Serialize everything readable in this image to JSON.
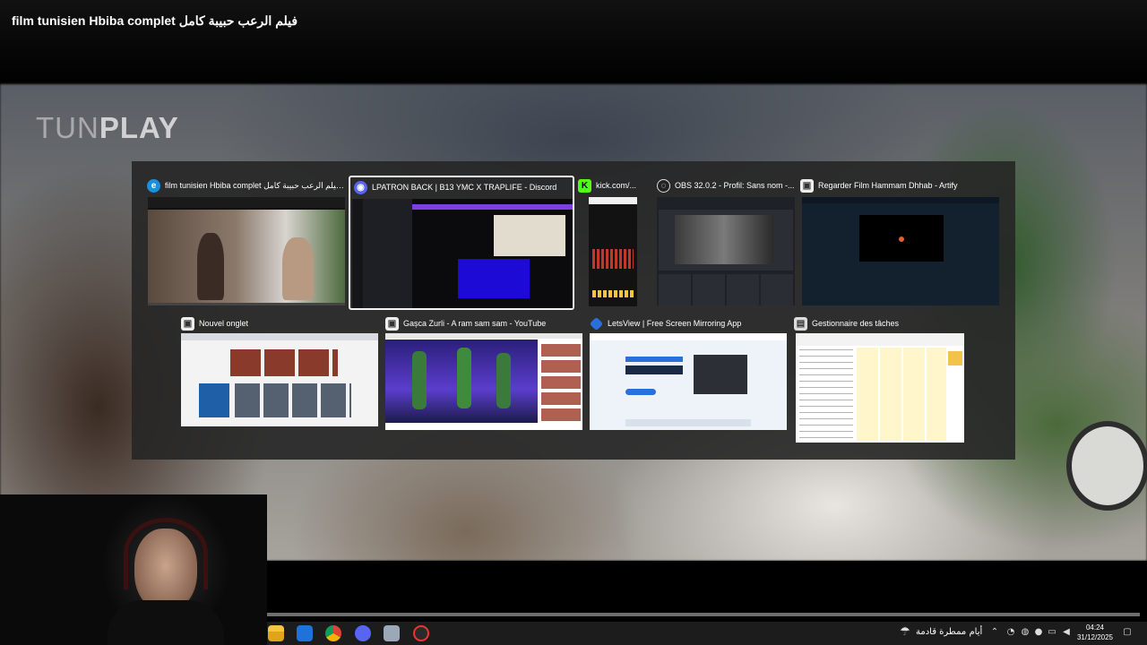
{
  "video": {
    "title": "film tunisien Hbiba complet فيلم الرعب حبيبة كامل",
    "watermark_light": "TUN",
    "watermark_bold": "PLAY"
  },
  "switcher": {
    "windows": [
      {
        "title": "film tunisien Hbiba complet فيلم الرعب حبيبة كامل...",
        "icon": "edge-icon",
        "selected": false
      },
      {
        "title": "LPATRON BACK | B13 YMC X TRAPLIFE - Discord",
        "icon": "discord-icon",
        "selected": true
      },
      {
        "title": "kick.com/...",
        "icon": "kick-icon",
        "selected": false
      },
      {
        "title": "OBS 32.0.2 - Profil: Sans nom -...",
        "icon": "obs-icon",
        "selected": false
      },
      {
        "title": "Regarder Film Hammam Dhhab - Artify",
        "icon": "browser-tab-icon",
        "selected": false
      },
      {
        "title": "Nouvel onglet",
        "icon": "browser-tab-icon",
        "selected": false
      },
      {
        "title": "Gașca Zurli - A ram sam sam - YouTube",
        "icon": "browser-tab-icon",
        "selected": false
      },
      {
        "title": "LetsView | Free Screen Mirroring App",
        "icon": "letsview-icon",
        "selected": false
      },
      {
        "title": "Gestionnaire des tâches",
        "icon": "task-manager-icon",
        "selected": false
      }
    ],
    "letsview_heading": "LetsView - Free Screen Mirroring App"
  },
  "taskbar": {
    "weather_text": "أيام ممطرة قادمة",
    "time": "04:24",
    "date": "31/12/2025"
  },
  "colors": {
    "discord": "#5865f2",
    "kick": "#53fc18",
    "edge": "#1b8fd9",
    "selection": "#f2f2f2"
  }
}
